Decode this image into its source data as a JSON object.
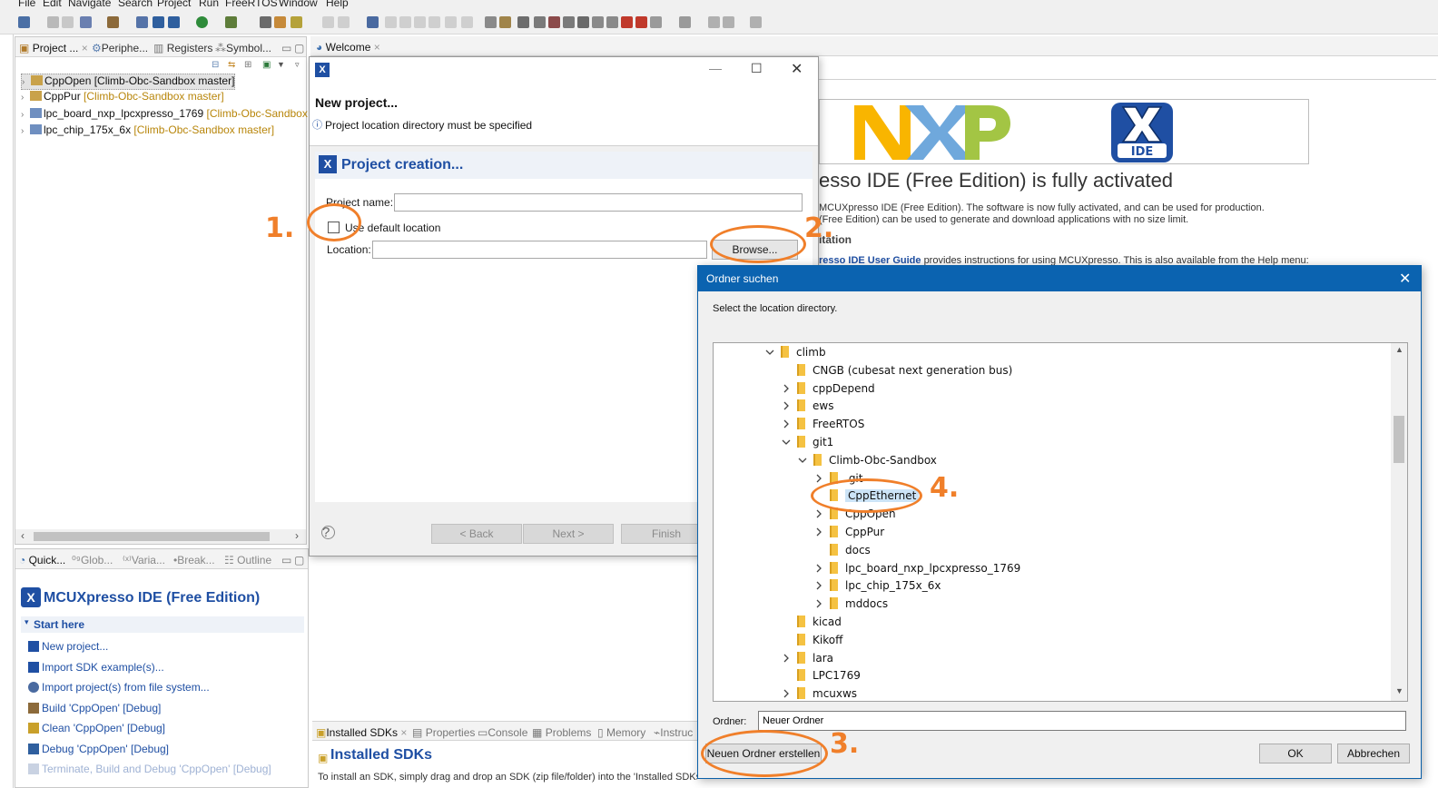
{
  "menubar": [
    "File",
    "Edit",
    "Navigate",
    "Search",
    "Project",
    "Run",
    "FreeRTOS",
    "Window",
    "Help"
  ],
  "project_view": {
    "tabs": [
      "Project ...",
      "Periphe...",
      "Registers",
      "Symbol..."
    ],
    "items": [
      {
        "name": "CppOpen",
        "branch": "[Climb-Obc-Sandbox master]"
      },
      {
        "name": "CppPur",
        "branch": "[Climb-Obc-Sandbox master]"
      },
      {
        "name": "lpc_board_nxp_lpcxpresso_1769",
        "branch": "[Climb-Obc-Sandbox m"
      },
      {
        "name": "lpc_chip_175x_6x",
        "branch": "[Climb-Obc-Sandbox master]"
      }
    ]
  },
  "quick_view": {
    "tabs": [
      "Quick...",
      "Glob...",
      "Varia...",
      "Break...",
      "Outline"
    ],
    "title": "MCUXpresso IDE (Free Edition)",
    "section": "Start here",
    "links": [
      "New project...",
      "Import SDK example(s)...",
      "Import project(s) from file system...",
      "Build 'CppOpen' [Debug]",
      "Clean 'CppOpen' [Debug]",
      "Debug 'CppOpen' [Debug]",
      "Terminate, Build and Debug 'CppOpen' [Debug]"
    ]
  },
  "welcome": {
    "tab": "Welcome",
    "heading": "esso IDE (Free Edition) is fully activated",
    "line1": "MCUXpresso IDE (Free Edition). The software is now fully activated, and can be used for production.",
    "line2": "(Free Edition) can be used to generate and download applications with no size limit.",
    "subheading": "itation",
    "guide_link": "resso IDE User Guide",
    "guide_rest": "provides instructions for using MCUXpresso. This is also available from the Help menu:",
    "logo_nxp": "NXP",
    "logo_ide": "IDE"
  },
  "sdk_panel": {
    "tabs": [
      "Installed SDKs",
      "Properties",
      "Console",
      "Problems",
      "Memory",
      "Instruc"
    ],
    "title": "Installed SDKs",
    "text": "To install an SDK, simply drag and drop an SDK (zip file/folder) into the 'Installed SDKs' view."
  },
  "wizard": {
    "title": "New project...",
    "message": "Project location directory must be specified",
    "page_title": "Project creation...",
    "project_name_label": "Project name:",
    "project_name_value": "",
    "use_default_label": "Use default location",
    "use_default_checked": false,
    "location_label": "Location:",
    "location_value": "",
    "browse_label": "Browse...",
    "back_label": "< Back",
    "next_label": "Next >",
    "finish_label": "Finish"
  },
  "folder_dialog": {
    "title": "Ordner suchen",
    "prompt": "Select the location directory.",
    "tree": [
      {
        "label": "climb",
        "level": 0,
        "expander": "open",
        "selected": false
      },
      {
        "label": "CNGB (cubesat next generation bus)",
        "level": 1,
        "expander": "none",
        "selected": false
      },
      {
        "label": "cppDepend",
        "level": 1,
        "expander": "closed",
        "selected": false
      },
      {
        "label": "ews",
        "level": 1,
        "expander": "closed",
        "selected": false
      },
      {
        "label": "FreeRTOS",
        "level": 1,
        "expander": "closed",
        "selected": false
      },
      {
        "label": "git1",
        "level": 1,
        "expander": "open",
        "selected": false
      },
      {
        "label": "Climb-Obc-Sandbox",
        "level": 2,
        "expander": "open",
        "selected": false
      },
      {
        "label": ".git",
        "level": 3,
        "expander": "closed",
        "selected": false
      },
      {
        "label": "CppEthernet",
        "level": 3,
        "expander": "none",
        "selected": true
      },
      {
        "label": "CppOpen",
        "level": 3,
        "expander": "closed",
        "selected": false
      },
      {
        "label": "CppPur",
        "level": 3,
        "expander": "closed",
        "selected": false
      },
      {
        "label": "docs",
        "level": 3,
        "expander": "none",
        "selected": false
      },
      {
        "label": "lpc_board_nxp_lpcxpresso_1769",
        "level": 3,
        "expander": "closed",
        "selected": false
      },
      {
        "label": "lpc_chip_175x_6x",
        "level": 3,
        "expander": "closed",
        "selected": false
      },
      {
        "label": "mddocs",
        "level": 3,
        "expander": "closed",
        "selected": false
      },
      {
        "label": "kicad",
        "level": 1,
        "expander": "none",
        "selected": false
      },
      {
        "label": "Kikoff",
        "level": 1,
        "expander": "none",
        "selected": false
      },
      {
        "label": "lara",
        "level": 1,
        "expander": "closed",
        "selected": false
      },
      {
        "label": "LPC1769",
        "level": 1,
        "expander": "none",
        "selected": false
      },
      {
        "label": "mcuxws",
        "level": 1,
        "expander": "closed",
        "selected": false
      }
    ],
    "folder_label": "Ordner:",
    "folder_value": "Neuer Ordner",
    "new_folder_label": "Neuen Ordner erstellen",
    "ok_label": "OK",
    "cancel_label": "Abbrechen"
  },
  "annotations": [
    "1.",
    "2.",
    "3.",
    "4."
  ],
  "colors": {
    "accent_orange": "#f07f2a",
    "dialog_title_blue": "#0b63b0",
    "link_blue": "#1f4fa3",
    "nxp_yellow": "#f9b500",
    "nxp_blue": "#6fa8dc",
    "nxp_green": "#a3c544"
  }
}
